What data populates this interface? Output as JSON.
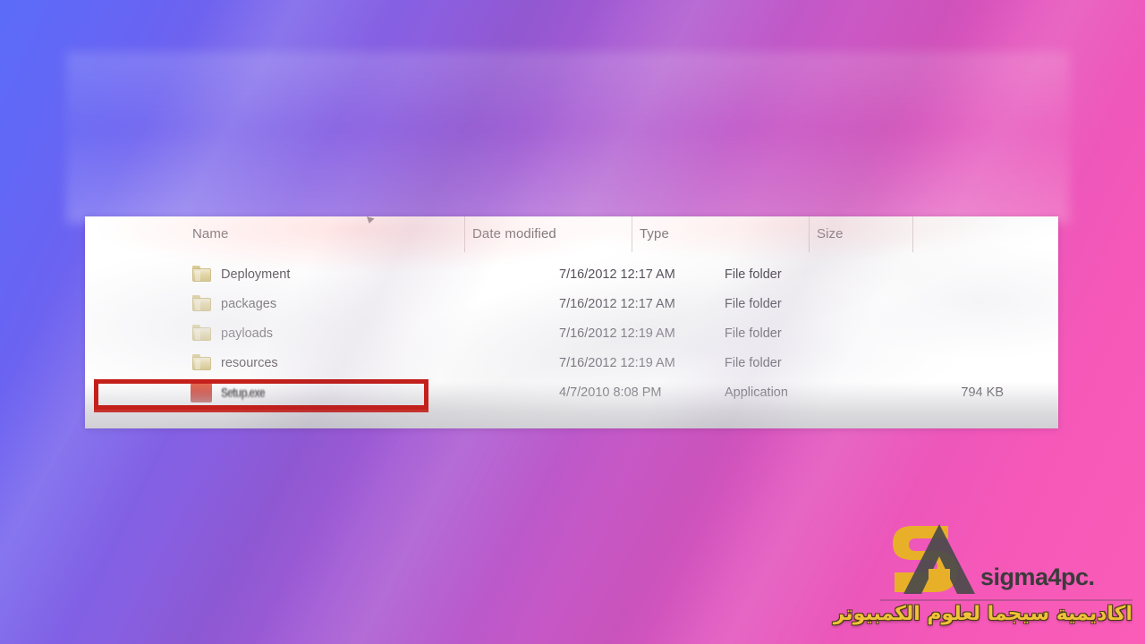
{
  "background": {
    "gradient_from": "#5b6cf9",
    "gradient_mid": "#a95ad2",
    "gradient_to": "#fa5cb8"
  },
  "explorer": {
    "columns": [
      {
        "key": "name",
        "label": "Name"
      },
      {
        "key": "date",
        "label": "Date modified"
      },
      {
        "key": "type",
        "label": "Type"
      },
      {
        "key": "size",
        "label": "Size"
      }
    ],
    "rows": [
      {
        "icon": "folder-icon",
        "name": "Deployment",
        "date": "7/16/2012 12:17 AM",
        "type": "File folder",
        "size": ""
      },
      {
        "icon": "folder-icon",
        "name": "packages",
        "date": "7/16/2012 12:17 AM",
        "type": "File folder",
        "size": ""
      },
      {
        "icon": "folder-icon",
        "name": "payloads",
        "date": "7/16/2012 12:19 AM",
        "type": "File folder",
        "size": ""
      },
      {
        "icon": "folder-icon",
        "name": "resources",
        "date": "7/16/2012 12:19 AM",
        "type": "File folder",
        "size": ""
      },
      {
        "icon": "application-icon",
        "name": "Setup.exe",
        "date": "4/7/2010 8:08 PM",
        "type": "Application",
        "size": "794 KB"
      }
    ],
    "highlight": {
      "color": "#c4201b",
      "target_row_index": 4
    },
    "sort_indicator": "sort-ascending-arrow"
  },
  "watermark": {
    "brand": "sigma4pc.",
    "arabic": "اكاديمية سيجما لعلوم الكمبيوتر",
    "logo_gold": "#e8b029",
    "logo_dark": "#4a4a4a"
  }
}
